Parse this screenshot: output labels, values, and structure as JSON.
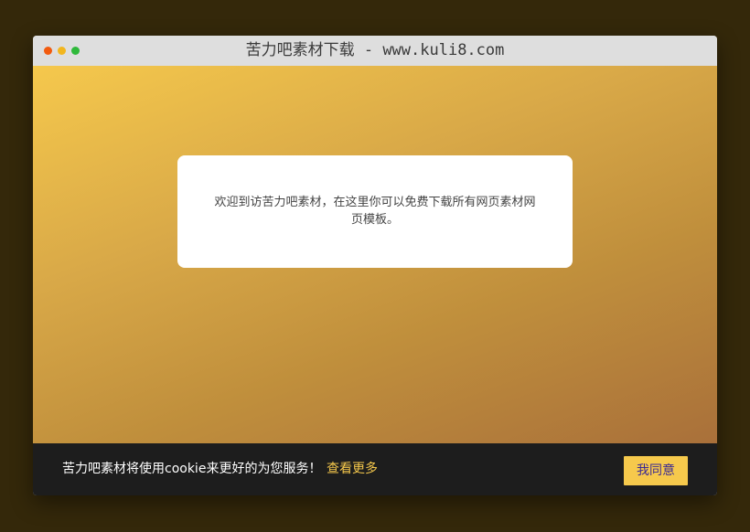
{
  "window": {
    "title": "苦力吧素材下载 - www.kuli8.com"
  },
  "notice": {
    "text": "欢迎到访苦力吧素材，在这里你可以免费下载所有网页素材网页模板。"
  },
  "cookie_bar": {
    "message": "苦力吧素材将使用cookie来更好的为您服务！",
    "learn_more_label": "查看更多",
    "agree_label": "我同意"
  },
  "colors": {
    "page_background": "#34280a",
    "gradient_top": "#f5c84c",
    "gradient_bottom": "#a9703a",
    "cookie_bar_background": "#1d1d1d",
    "accent": "#f5c84c",
    "button_text": "#3b2a93"
  }
}
